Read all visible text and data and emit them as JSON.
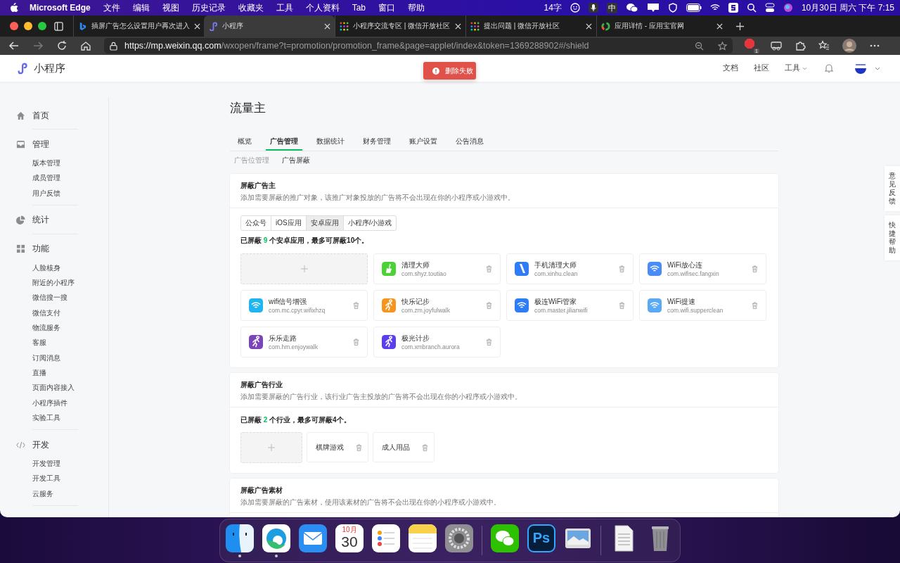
{
  "menubar": {
    "app": "Microsoft Edge",
    "menus": [
      "文件",
      "编辑",
      "视图",
      "历史记录",
      "收藏夹",
      "工具",
      "个人资料",
      "Tab",
      "窗口",
      "帮助"
    ],
    "word_count": "14字",
    "input_method": "中",
    "clock": "10月30日 周六 下午 7:15"
  },
  "tabs": [
    {
      "title": "插屏广告怎么设置用户再次进入",
      "kind": "bing",
      "selected": false
    },
    {
      "title": "小程序",
      "kind": "mini",
      "selected": true
    },
    {
      "title": "小程序交流专区 | 微信开放社区",
      "kind": "dots",
      "selected": false
    },
    {
      "title": "提出问题 | 微信开放社区",
      "kind": "dots",
      "selected": false
    },
    {
      "title": "应用详情 - 应用宝官网",
      "kind": "ring",
      "selected": false
    }
  ],
  "address": {
    "host": "https://mp.weixin.qq.com",
    "path": "/wxopen/frame?t=promotion/promotion_frame&page=applet/index&token=1369288902#/shield"
  },
  "extension_badge": "1",
  "header": {
    "logo": "小程序",
    "nav": [
      {
        "label": "文档",
        "dropdown": false
      },
      {
        "label": "社区",
        "dropdown": false
      },
      {
        "label": "工具",
        "dropdown": true
      }
    ]
  },
  "toast": "删除失败",
  "sidebar": [
    {
      "kind": "home",
      "title": "首页"
    },
    {
      "kind": "inbox",
      "title": "管理",
      "items": [
        "版本管理",
        "成员管理",
        "用户反馈"
      ]
    },
    {
      "kind": "pie",
      "title": "统计"
    },
    {
      "kind": "grid",
      "title": "功能",
      "items": [
        "人脸核身",
        "附近的小程序",
        "微信搜一搜",
        "微信支付",
        "物流服务",
        "客服",
        "订阅消息",
        "直播",
        "页面内容接入",
        "小程序插件",
        "实验工具"
      ]
    },
    {
      "kind": "code",
      "title": "开发",
      "items": [
        "开发管理",
        "开发工具",
        "云服务"
      ]
    }
  ],
  "page_title": "流量主",
  "main_tabs": [
    {
      "label": "概览",
      "selected": false
    },
    {
      "label": "广告管理",
      "selected": true
    },
    {
      "label": "数据统计",
      "selected": false
    },
    {
      "label": "财务管理",
      "selected": false
    },
    {
      "label": "账户设置",
      "selected": false
    },
    {
      "label": "公告消息",
      "selected": false
    }
  ],
  "sub_tabs": [
    {
      "label": "广告位管理",
      "selected": false
    },
    {
      "label": "广告屏蔽",
      "selected": true
    }
  ],
  "advertisers": {
    "title": "屏蔽广告主",
    "description": "添加需要屏蔽的推广对象，该推广对象投放的广告将不会出现在你的小程序或小游戏中。",
    "types": [
      {
        "label": "公众号",
        "selected": false
      },
      {
        "label": "iOS应用",
        "selected": false
      },
      {
        "label": "安卓应用",
        "selected": true
      },
      {
        "label": "小程序/小游戏",
        "selected": false
      }
    ],
    "summary": {
      "prefix": "已屏蔽",
      "count": "9",
      "suffix": "个安卓应用，最多可屏蔽10个。"
    },
    "apps": [
      {
        "name": "清理大师",
        "package": "com.shyz.toutiao",
        "kind": "broom",
        "color": "#4cd137"
      },
      {
        "name": "手机清理大师",
        "package": "com.xinhu.clean",
        "kind": "wand",
        "color": "#2f7cf6"
      },
      {
        "name": "WiFi放心连",
        "package": "com.wifisec.fangxin",
        "kind": "wifi",
        "color": "#4a8cf7"
      },
      {
        "name": "wifi信号增强",
        "package": "com.mc.cpyr.wifixhzq",
        "kind": "wifi",
        "color": "#1fb5f0"
      },
      {
        "name": "快乐记步",
        "package": "com.zm.joyfulwalk",
        "kind": "walker",
        "color": "#f7941d"
      },
      {
        "name": "极连WiFi管家",
        "package": "com.master.jilianwifi",
        "kind": "wifi",
        "color": "#2e7cf6"
      },
      {
        "name": "WiFi提速",
        "package": "com.wifi.supperclean",
        "kind": "wifi",
        "color": "#5aa9f5"
      },
      {
        "name": "乐乐走路",
        "package": "com.hm.enjoywalk",
        "kind": "walker",
        "color": "#7b45b8"
      },
      {
        "name": "极光计步",
        "package": "com.xmbranch.aurora",
        "kind": "walker",
        "color": "#5b3ef0"
      }
    ]
  },
  "industries": {
    "title": "屏蔽广告行业",
    "description": "添加需要屏蔽的广告行业，该行业广告主投放的广告将不会出现在你的小程序或小游戏中。",
    "summary": {
      "prefix": "已屏蔽",
      "count": "2",
      "suffix": "个行业，最多可屏蔽4个。"
    },
    "items": [
      "棋牌游戏",
      "成人用品"
    ]
  },
  "materials": {
    "title": "屏蔽广告素材",
    "description": "添加需要屏蔽的广告素材，使用该素材的广告将不会出现在你的小程序或小游戏中。"
  },
  "side_buttons": [
    "意见反馈",
    "快捷帮助"
  ],
  "dock": [
    {
      "kind": "finder",
      "running": true
    },
    {
      "kind": "edge",
      "running": true
    },
    {
      "kind": "mail",
      "running": false
    },
    {
      "kind": "calendar",
      "month": "10月",
      "day": "30",
      "running": false
    },
    {
      "kind": "reminders",
      "running": false
    },
    {
      "kind": "notes",
      "running": false
    },
    {
      "kind": "settings",
      "running": false
    },
    {
      "kind": "separator"
    },
    {
      "kind": "wechat",
      "running": false
    },
    {
      "kind": "ps",
      "label": "Ps",
      "running": false
    },
    {
      "kind": "preview",
      "running": false
    },
    {
      "kind": "separator"
    },
    {
      "kind": "document",
      "running": false
    },
    {
      "kind": "trash",
      "running": false
    }
  ]
}
